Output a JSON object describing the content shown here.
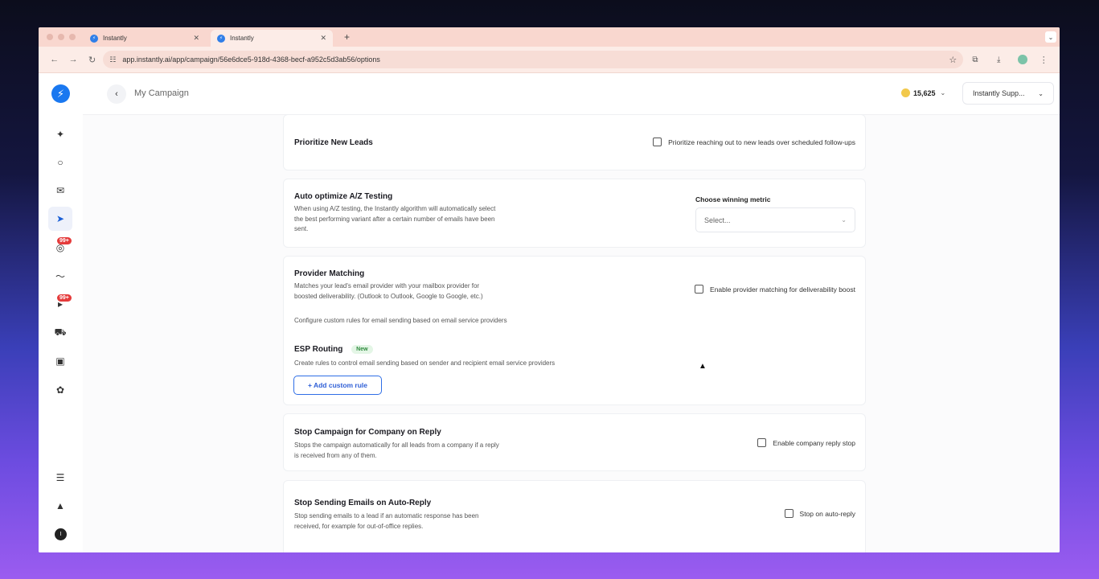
{
  "browser": {
    "tabs": [
      {
        "title": "Instantly"
      },
      {
        "title": "Instantly"
      }
    ],
    "url": "app.instantly.ai/app/campaign/56e6dce5-918d-4368-becf-a952c5d3ab56/options"
  },
  "header": {
    "breadcrumb": "My Campaign",
    "credits": "15,625",
    "workspace": "Instantly Supp..."
  },
  "sidebar": {
    "badges": [
      "99+",
      "99+"
    ],
    "avatar_initial": "I"
  },
  "cards": {
    "prioritize": {
      "title": "Prioritize New Leads",
      "checkbox_label": "Prioritize reaching out to new leads over scheduled follow-ups"
    },
    "ab_testing": {
      "title": "Auto optimize A/Z Testing",
      "description": "When using A/Z testing, the Instantly algorithm will automatically select the best performing variant after a certain number of emails have been sent.",
      "metric_label": "Choose winning metric",
      "metric_placeholder": "Select..."
    },
    "provider_matching": {
      "title": "Provider Matching",
      "description": "Matches your lead's email provider with your mailbox provider for boosted deliverability. (Outlook to Outlook, Google to Google, etc.)",
      "configure_text": "Configure custom rules for email sending based on email service providers",
      "checkbox_label": "Enable provider matching for deliverability boost",
      "esp_title": "ESP Routing",
      "esp_badge": "New",
      "esp_description": "Create rules to control email sending based on sender and recipient email service providers",
      "add_rule_label": "+ Add custom rule"
    },
    "company_stop": {
      "title": "Stop Campaign for Company on Reply",
      "description": "Stops the campaign automatically for all leads from a company if a reply is received from any of them.",
      "checkbox_label": "Enable company reply stop"
    },
    "auto_reply": {
      "title": "Stop Sending Emails on Auto-Reply",
      "description": "Stop sending emails to a lead if an automatic response has been received, for example for out-of-office replies.",
      "checkbox_label": "Stop on auto-reply"
    }
  },
  "colors": {
    "accent": "#1a78f0",
    "badge": "#e53b3b",
    "tabbar": "#f9d7cf"
  }
}
